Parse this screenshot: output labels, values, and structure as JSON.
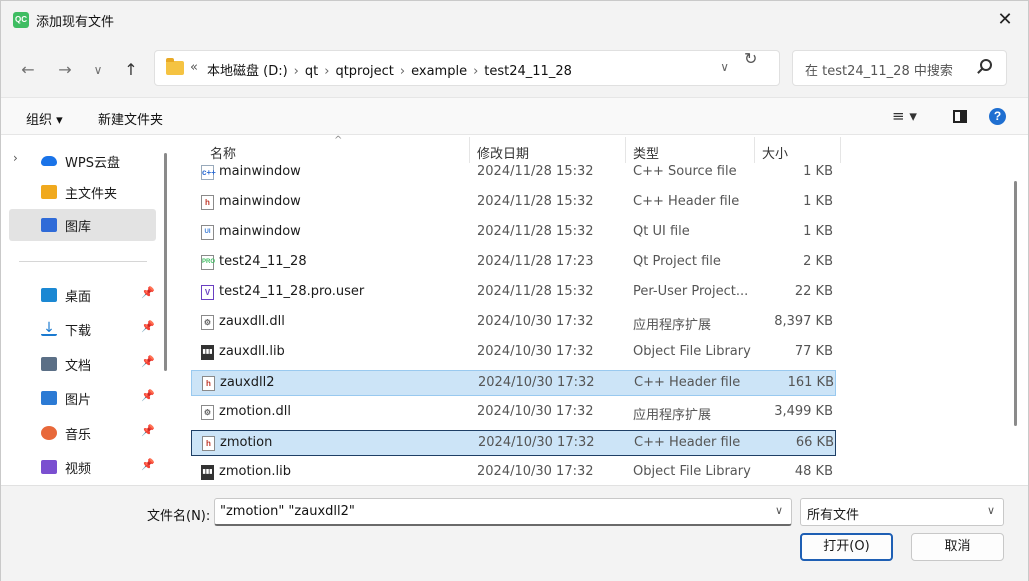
{
  "window": {
    "app_icon_text": "QC",
    "title": "添加现有文件",
    "close": "✕"
  },
  "nav": {
    "back": "←",
    "forward": "→",
    "recent": "∨",
    "up": "↑",
    "chevrons": "«",
    "breadcrumbs": [
      "本地磁盘 (D:)",
      "qt",
      "qtproject",
      "example",
      "test24_11_28"
    ],
    "separator": "›",
    "dropdown": "∨",
    "refresh": "↻",
    "search_placeholder": "在 test24_11_28 中搜索"
  },
  "toolbar": {
    "organize": "组织 ▾",
    "new_folder": "新建文件夹",
    "view": "≡ ▾",
    "help": "?"
  },
  "sidebar": {
    "items": [
      {
        "label": "WPS云盘",
        "expand": "›",
        "icon": "cloud-icon"
      },
      {
        "label": "主文件夹",
        "icon": "home-icon"
      },
      {
        "label": "图库",
        "icon": "gallery-icon"
      },
      {
        "label": "桌面",
        "icon": "desktop-icon",
        "pin": "📌"
      },
      {
        "label": "下载",
        "icon": "download-icon",
        "pin": "📌"
      },
      {
        "label": "文档",
        "icon": "documents-icon",
        "pin": "📌"
      },
      {
        "label": "图片",
        "icon": "pictures-icon",
        "pin": "📌"
      },
      {
        "label": "音乐",
        "icon": "music-icon",
        "pin": "📌"
      },
      {
        "label": "视频",
        "icon": "video-icon",
        "pin": "📌"
      }
    ]
  },
  "filelist": {
    "columns": {
      "name": "名称",
      "date": "修改日期",
      "type": "类型",
      "size": "大小"
    },
    "sort_arrow": "^",
    "rows": [
      {
        "name": "mainwindow",
        "date": "2024/11/28 15:32",
        "type": "C++ Source file",
        "size": "1 KB",
        "icon": "cpp",
        "icon_text": "c++"
      },
      {
        "name": "mainwindow",
        "date": "2024/11/28 15:32",
        "type": "C++ Header file",
        "size": "1 KB",
        "icon": "h",
        "icon_text": "h"
      },
      {
        "name": "mainwindow",
        "date": "2024/11/28 15:32",
        "type": "Qt UI file",
        "size": "1 KB",
        "icon": "ui",
        "icon_text": "UI"
      },
      {
        "name": "test24_11_28",
        "date": "2024/11/28 17:23",
        "type": "Qt Project file",
        "size": "2 KB",
        "icon": "pro",
        "icon_text": "PRO"
      },
      {
        "name": "test24_11_28.pro.user",
        "date": "2024/11/28 15:32",
        "type": "Per-User Project...",
        "size": "22 KB",
        "icon": "user",
        "icon_text": "V"
      },
      {
        "name": "zauxdll.dll",
        "date": "2024/10/30 17:32",
        "type": "应用程序扩展",
        "size": "8,397 KB",
        "icon": "dll",
        "icon_text": "⚙"
      },
      {
        "name": "zauxdll.lib",
        "date": "2024/10/30 17:32",
        "type": "Object File Library",
        "size": "77 KB",
        "icon": "lib",
        "icon_text": "▮▮▮"
      },
      {
        "name": "zauxdll2",
        "date": "2024/10/30 17:32",
        "type": "C++ Header file",
        "size": "161 KB",
        "icon": "h",
        "icon_text": "h",
        "state": "selected"
      },
      {
        "name": "zmotion.dll",
        "date": "2024/10/30 17:32",
        "type": "应用程序扩展",
        "size": "3,499 KB",
        "icon": "dll",
        "icon_text": "⚙"
      },
      {
        "name": "zmotion",
        "date": "2024/10/30 17:32",
        "type": "C++ Header file",
        "size": "66 KB",
        "icon": "h",
        "icon_text": "h",
        "state": "focused"
      },
      {
        "name": "zmotion.lib",
        "date": "2024/10/30 17:32",
        "type": "Object File Library",
        "size": "48 KB",
        "icon": "lib",
        "icon_text": "▮▮▮"
      }
    ]
  },
  "bottom": {
    "filename_label": "文件名(N):",
    "filename_value": "\"zmotion\" \"zauxdll2\"",
    "filetype_value": "所有文件",
    "dropdown": "∨",
    "open_button": "打开(O)",
    "cancel_button": "取消"
  }
}
